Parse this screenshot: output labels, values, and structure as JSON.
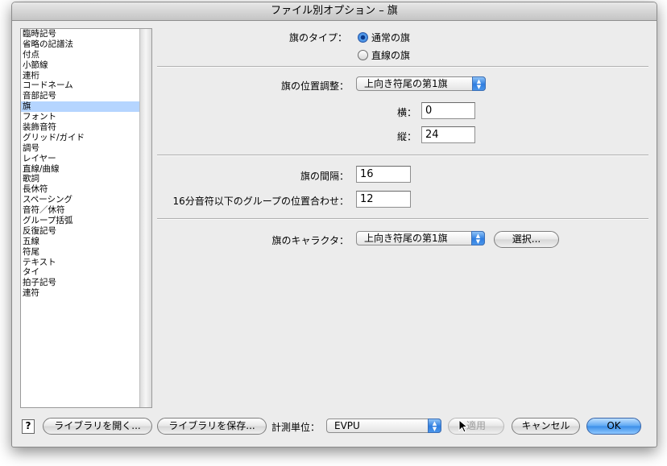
{
  "window": {
    "title": "ファイル別オプション – 旗"
  },
  "categories": {
    "items": [
      "臨時記号",
      "省略の記譜法",
      "付点",
      "小節線",
      "連桁",
      "コードネーム",
      "音部記号",
      "旗",
      "フォント",
      "装飾音符",
      "グリッド/ガイド",
      "調号",
      "レイヤー",
      "直線/曲線",
      "歌詞",
      "長休符",
      "スペーシング",
      "音符／休符",
      "グループ括弧",
      "反復記号",
      "五線",
      "符尾",
      "テキスト",
      "タイ",
      "拍子記号",
      "連符"
    ],
    "selected_index": 7
  },
  "flag_type": {
    "label": "旗のタイプ：",
    "options": [
      "通常の旗",
      "直線の旗"
    ],
    "selected": "通常の旗"
  },
  "flag_position": {
    "label": "旗の位置調整：",
    "popup_value": "上向き符尾の第1旗",
    "horizontal_label": "横：",
    "horizontal_value": "0",
    "vertical_label": "縦：",
    "vertical_value": "24"
  },
  "spacing": {
    "flag_spacing_label": "旗の間隔：",
    "flag_spacing_value": "16",
    "group_align_label": "16分音符以下のグループの位置合わせ：",
    "group_align_value": "12"
  },
  "flag_character": {
    "label": "旗のキャラクタ：",
    "popup_value": "上向き符尾の第1旗",
    "select_button": "選択..."
  },
  "footer": {
    "help": "?",
    "open_library": "ライブラリを開く...",
    "save_library": "ライブラリを保存...",
    "units_label": "計測単位：",
    "units_value": "EVPU",
    "apply": "適用",
    "cancel": "キャンセル",
    "ok": "OK"
  }
}
